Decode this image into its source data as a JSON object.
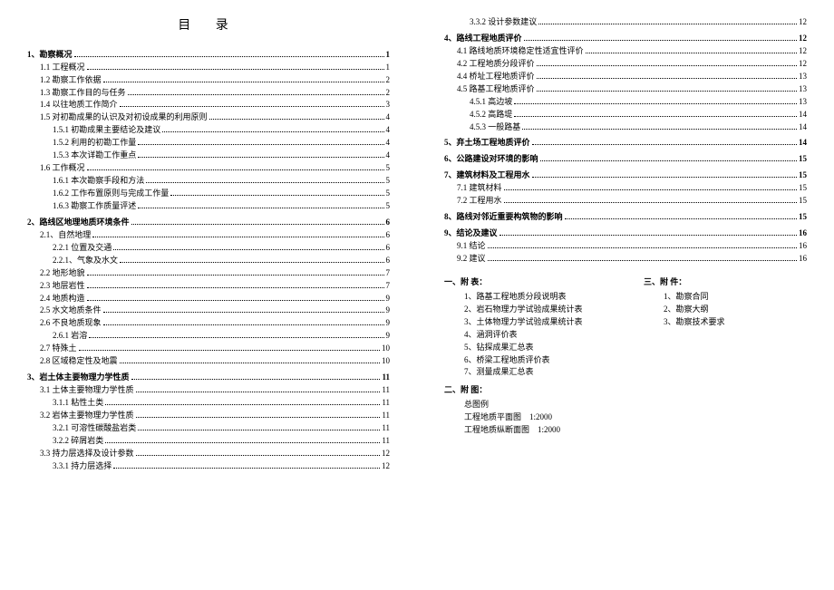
{
  "title": "目  录",
  "sections": [
    {
      "level": 0,
      "num": "1、",
      "text": "勘察概况",
      "page": "1"
    },
    {
      "level": 1,
      "num": "1.1",
      "text": " 工程概况",
      "page": "1"
    },
    {
      "level": 1,
      "num": "1.2",
      "text": " 勘察工作依据",
      "page": "2"
    },
    {
      "level": 1,
      "num": "1.3",
      "text": " 勘察工作目的与任务",
      "page": "2"
    },
    {
      "level": 1,
      "num": "1.4",
      "text": " 以往地质工作简介",
      "page": "3"
    },
    {
      "level": 1,
      "num": "1.5",
      "text": " 对初勘成果的认识及对初设成果的利用原则",
      "page": "4"
    },
    {
      "level": 2,
      "num": "1.5.1",
      "text": " 初勘成果主要结论及建议",
      "page": "4"
    },
    {
      "level": 2,
      "num": "1.5.2",
      "text": " 利用的初勘工作量",
      "page": "4"
    },
    {
      "level": 2,
      "num": "1.5.3",
      "text": " 本次详勘工作重点",
      "page": "4"
    },
    {
      "level": 1,
      "num": "1.6",
      "text": " 工作概况",
      "page": "5"
    },
    {
      "level": 2,
      "num": "1.6.1",
      "text": " 本次勘察手段和方法",
      "page": "5"
    },
    {
      "level": 2,
      "num": "1.6.2",
      "text": " 工作布置原则与完成工作量",
      "page": "5"
    },
    {
      "level": 2,
      "num": "1.6.3",
      "text": " 勘察工作质量评述",
      "page": "5"
    },
    {
      "level": 0,
      "num": "2、",
      "text": "路线区地理地质环境条件",
      "page": "6"
    },
    {
      "level": 1,
      "num": "2.1、",
      "text": "自然地理",
      "page": "6"
    },
    {
      "level": 2,
      "num": "2.2.1",
      "text": " 位置及交通",
      "page": "6"
    },
    {
      "level": 2,
      "num": "2.2.1、",
      "text": "气象及水文",
      "page": "6"
    },
    {
      "level": 1,
      "num": "2.2",
      "text": " 地形地貌",
      "page": "7"
    },
    {
      "level": 1,
      "num": "2.3",
      "text": " 地层岩性",
      "page": "7"
    },
    {
      "level": 1,
      "num": "2.4",
      "text": " 地质构造",
      "page": "9"
    },
    {
      "level": 1,
      "num": "2.5",
      "text": " 水文地质条件",
      "page": "9"
    },
    {
      "level": 1,
      "num": "2.6",
      "text": " 不良地质现象",
      "page": "9"
    },
    {
      "level": 2,
      "num": "2.6.1  ",
      "text": "岩溶",
      "page": "9"
    },
    {
      "level": 1,
      "num": "2.7",
      "text": " 特殊土",
      "page": "10"
    },
    {
      "level": 1,
      "num": "2.8",
      "text": " 区域稳定性及地震",
      "page": "10"
    },
    {
      "level": 0,
      "num": "3、",
      "text": "岩土体主要物理力学性质",
      "page": "11"
    },
    {
      "level": 1,
      "num": "3.1",
      "text": " 土体主要物理力学性质",
      "page": "11"
    },
    {
      "level": 2,
      "num": "3.1.1",
      "text": " 粘性土类",
      "page": "11"
    },
    {
      "level": 1,
      "num": "3.2",
      "text": " 岩体主要物理力学性质",
      "page": "11"
    },
    {
      "level": 2,
      "num": "3.2.1",
      "text": " 可溶性碳酸盐岩类",
      "page": "11"
    },
    {
      "level": 2,
      "num": "3.2.2",
      "text": " 碎屑岩类",
      "page": "11"
    },
    {
      "level": 1,
      "num": "3.3",
      "text": " 持力层选择及设计参数",
      "page": "12"
    },
    {
      "level": 2,
      "num": "3.3.1",
      "text": " 持力层选择",
      "page": "12"
    }
  ],
  "sections2": [
    {
      "level": 2,
      "num": "3.3.2",
      "text": " 设计参数建议",
      "page": "12"
    },
    {
      "level": 0,
      "num": "4、",
      "text": "路线工程地质评价",
      "page": "12"
    },
    {
      "level": 1,
      "num": "4.1",
      "text": " 路线地质环境稳定性适宜性评价",
      "page": "12"
    },
    {
      "level": 1,
      "num": "4.2",
      "text": " 工程地质分段评价",
      "page": "12"
    },
    {
      "level": 1,
      "num": "4.4",
      "text": " 桥址工程地质评价",
      "page": "13"
    },
    {
      "level": 1,
      "num": "4.5",
      "text": " 路基工程地质评价",
      "page": "13"
    },
    {
      "level": 2,
      "num": "4.5.1",
      "text": " 高边坡",
      "page": "13"
    },
    {
      "level": 2,
      "num": "4.5.2",
      "text": " 高路堤",
      "page": "14"
    },
    {
      "level": 2,
      "num": "4.5.3",
      "text": " 一般路基",
      "page": "14"
    },
    {
      "level": 0,
      "num": "5、",
      "text": "弃土场工程地质评价",
      "page": "14"
    },
    {
      "level": 0,
      "num": "6、",
      "text": "公路建设对环境的影响",
      "page": "15"
    },
    {
      "level": 0,
      "num": "7、",
      "text": "建筑材料及工程用水",
      "page": "15"
    },
    {
      "level": 1,
      "num": "7.1",
      "text": " 建筑材料",
      "page": "15"
    },
    {
      "level": 1,
      "num": "7.2",
      "text": " 工程用水",
      "page": "15"
    },
    {
      "level": 0,
      "num": "8、",
      "text": "路线对邻近重要构筑物的影响",
      "page": "15"
    },
    {
      "level": 0,
      "num": "9、",
      "text": "结论及建议",
      "page": "16"
    },
    {
      "level": 1,
      "num": "9.1",
      "text": " 结论",
      "page": "16"
    },
    {
      "level": 1,
      "num": "9.2",
      "text": " 建议",
      "page": "16"
    }
  ],
  "appendixA": {
    "heading": "一、附   表：",
    "items": [
      "1、路基工程地质分段说明表",
      "2、岩石物理力学试验成果统计表",
      "3、土体物理力学试验成果统计表",
      "4、涵洞评价表",
      "5、钻探成果汇总表",
      "6、桥梁工程地质评价表",
      "7、测量成果汇总表"
    ]
  },
  "appendixB": {
    "heading": "二、附   图：",
    "first": "总图例",
    "items": [
      {
        "name": "工程地质平面图",
        "scale": "1:2000"
      },
      {
        "name": "工程地质纵断面图",
        "scale": "1:2000"
      }
    ]
  },
  "appendixC": {
    "heading": "三、附 件：",
    "items": [
      "1、勘察合同",
      "2、勘察大纲",
      "3、勘察技术要求"
    ]
  }
}
